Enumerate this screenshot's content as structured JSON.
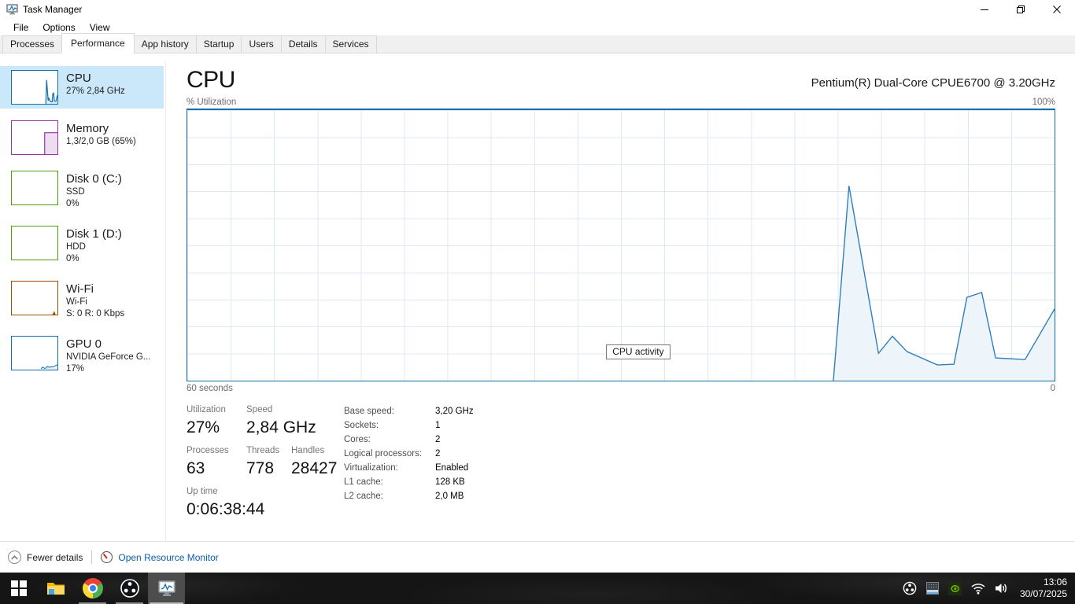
{
  "window": {
    "title": "Task Manager"
  },
  "menu": {
    "items": [
      "File",
      "Options",
      "View"
    ]
  },
  "tabs": {
    "items": [
      "Processes",
      "Performance",
      "App history",
      "Startup",
      "Users",
      "Details",
      "Services"
    ],
    "active": "Performance"
  },
  "sidebar": {
    "items": [
      {
        "title": "CPU",
        "line1": "27% 2,84 GHz",
        "line2": "",
        "color": "#1170aa",
        "selected": true,
        "chart": {
          "stroke": "#1170aa",
          "fill": "#dcebf6",
          "width": 1.2,
          "points": [
            [
              74.5,
              0
            ],
            [
              76.3,
              72
            ],
            [
              79.7,
              10.1
            ],
            [
              81.3,
              16.4
            ],
            [
              83,
              10.7
            ],
            [
              86.5,
              5.8
            ],
            [
              88.4,
              6.1
            ],
            [
              89.9,
              30.8
            ],
            [
              91.6,
              32.6
            ],
            [
              93.2,
              8.4
            ],
            [
              96.6,
              7.8
            ],
            [
              100,
              26.5
            ]
          ]
        }
      },
      {
        "title": "Memory",
        "line1": "1,3/2,0 GB (65%)",
        "line2": "",
        "color": "#9b30a8",
        "chart": {
          "stroke": "#9b30a8",
          "fill": "#eadef0",
          "width": 1.2,
          "points": [
            [
              72,
              0
            ],
            [
              72,
              65
            ],
            [
              100,
              65
            ]
          ]
        }
      },
      {
        "title": "Disk 0 (C:)",
        "line1": "SSD",
        "line2": "0%",
        "color": "#4aa300",
        "chart": {
          "stroke": "#4aa300",
          "fill": "none",
          "points": []
        }
      },
      {
        "title": "Disk 1 (D:)",
        "line1": "HDD",
        "line2": "0%",
        "color": "#4aa300",
        "chart": {
          "stroke": "#4aa300",
          "fill": "none",
          "points": []
        }
      },
      {
        "title": "Wi-Fi",
        "line1": "Wi-Fi",
        "line2": "S: 0 R: 0 Kbps",
        "color": "#a04b00",
        "chart": {
          "stroke": "#a04b00",
          "fill": "#a04b00",
          "width": 1,
          "points": [
            [
              90,
              0
            ],
            [
              93,
              8
            ],
            [
              95,
              0
            ]
          ]
        }
      },
      {
        "title": "GPU 0",
        "line1": "NVIDIA GeForce G...",
        "line2": "17%",
        "color": "#1170aa",
        "chart": {
          "stroke": "#1170aa",
          "fill": "#e8f2fa",
          "width": 1,
          "points": [
            [
              64,
              3
            ],
            [
              68,
              8
            ],
            [
              71,
              4
            ],
            [
              75,
              5
            ],
            [
              78,
              10
            ],
            [
              82,
              7
            ],
            [
              86,
              9
            ],
            [
              90,
              8
            ],
            [
              100,
              15
            ]
          ]
        }
      }
    ]
  },
  "main": {
    "title": "CPU",
    "subtitle": "Pentium(R) Dual-Core CPUE6700 @ 3.20GHz",
    "chart": {
      "y_label": "% Utilization",
      "y_max": "100%",
      "x_left": "60 seconds",
      "x_right": "0",
      "tooltip": "CPU activity",
      "stroke": "#2f7fba",
      "fill": "#edf4fa",
      "width": 1.4,
      "points": [
        [
          74.5,
          0
        ],
        [
          76.3,
          72
        ],
        [
          79.7,
          10.1
        ],
        [
          81.3,
          16.4
        ],
        [
          83,
          10.7
        ],
        [
          86.5,
          5.8
        ],
        [
          88.4,
          6.1
        ],
        [
          89.9,
          30.8
        ],
        [
          91.6,
          32.6
        ],
        [
          93.2,
          8.4
        ],
        [
          96.6,
          7.8
        ],
        [
          100,
          26.5
        ]
      ]
    },
    "stats": [
      {
        "label": "Utilization",
        "value": "27%"
      },
      {
        "label": "Speed",
        "value": "2,84 GHz"
      },
      {
        "label": "Processes",
        "value": "63"
      },
      {
        "label": "Threads",
        "value": "778"
      },
      {
        "label": "Handles",
        "value": "28427"
      },
      {
        "label": "Up time",
        "value": "0:06:38:44"
      }
    ],
    "details": [
      {
        "label": "Base speed:",
        "value": "3,20 GHz"
      },
      {
        "label": "Sockets:",
        "value": "1"
      },
      {
        "label": "Cores:",
        "value": "2"
      },
      {
        "label": "Logical processors:",
        "value": "2"
      },
      {
        "label": "Virtualization:",
        "value": "Enabled"
      },
      {
        "label": "L1 cache:",
        "value": "128 KB"
      },
      {
        "label": "L2 cache:",
        "value": "2,0 MB"
      }
    ]
  },
  "footer": {
    "collapse_label": "Fewer details",
    "resource_link": "Open Resource Monitor"
  },
  "taskbar": {
    "clock": {
      "time": "13:06",
      "date": "30/07/2025"
    }
  }
}
